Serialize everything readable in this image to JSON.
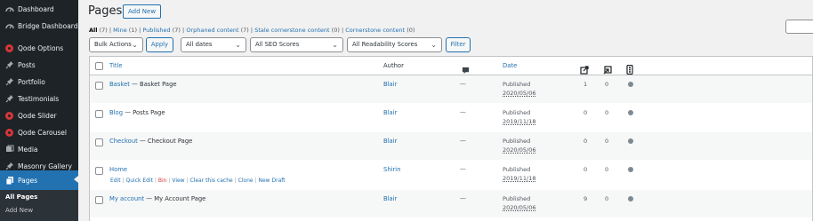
{
  "sidebar": {
    "items": [
      {
        "label": "Dashboard",
        "icon": "dashboard-icon"
      },
      {
        "label": "Bridge Dashboard",
        "icon": "bridge-icon"
      },
      {
        "label": "Qode Options",
        "icon": "qode-icon"
      },
      {
        "label": "Posts",
        "icon": "pin-icon"
      },
      {
        "label": "Portfolio",
        "icon": "pin-icon"
      },
      {
        "label": "Testimonials",
        "icon": "pin-icon"
      },
      {
        "label": "Qode Slider",
        "icon": "qode-icon"
      },
      {
        "label": "Qode Carousel",
        "icon": "qode-icon"
      },
      {
        "label": "Media",
        "icon": "media-icon"
      },
      {
        "label": "Masonry Gallery",
        "icon": "pin-icon"
      },
      {
        "label": "Pages",
        "icon": "pages-icon"
      }
    ],
    "submenu": {
      "all_pages": "All Pages",
      "add_new": "Add New"
    }
  },
  "header": {
    "title": "Pages",
    "add_new": "Add New"
  },
  "filters_links": {
    "all": "All",
    "all_count": "(7)",
    "mine": "Mine",
    "mine_count": "(1)",
    "published": "Published",
    "published_count": "(7)",
    "orphaned": "Orphaned content",
    "orphaned_count": "(7)",
    "stale": "Stale cornerstone content",
    "stale_count": "(0)",
    "cornerstone": "Cornerstone content",
    "cornerstone_count": "(0)",
    "sep": "|"
  },
  "toolbar": {
    "bulk_actions": "Bulk Actions",
    "apply": "Apply",
    "all_dates": "All dates",
    "seo_scores": "All SEO Scores",
    "readability_scores": "All Readability Scores",
    "filter": "Filter"
  },
  "table": {
    "headers": {
      "title": "Title",
      "author": "Author",
      "date": "Date"
    },
    "rows": [
      {
        "title": "Basket",
        "suffix": " — Basket Page",
        "author": "Blair",
        "comments": "—",
        "status": "Published",
        "date": "2020/05/06",
        "links_out": "1",
        "links_in": "0"
      },
      {
        "title": "Blog",
        "suffix": " — Posts Page",
        "author": "Blair",
        "comments": "—",
        "status": "Published",
        "date": "2019/11/18",
        "links_out": "0",
        "links_in": "0"
      },
      {
        "title": "Checkout",
        "suffix": " — Checkout Page",
        "author": "Blair",
        "comments": "—",
        "status": "Published",
        "date": "2020/05/06",
        "links_out": "0",
        "links_in": "0"
      },
      {
        "title": "Home",
        "suffix": "",
        "author": "Shirin",
        "comments": "—",
        "status": "Published",
        "date": "2019/11/18",
        "links_out": "0",
        "links_in": "0"
      },
      {
        "title": "My account",
        "suffix": " — My Account Page",
        "author": "Blair",
        "comments": "—",
        "status": "Published",
        "date": "2020/05/06",
        "links_out": "9",
        "links_in": "0"
      }
    ],
    "row_actions": {
      "edit": "Edit",
      "quick_edit": "Quick Edit",
      "bin": "Bin",
      "view": "View",
      "clear_cache": "Clear this cache",
      "clone": "Clone",
      "new_draft": "New Draft",
      "sep": "|"
    }
  },
  "colors": {
    "accent": "#2271b1",
    "sidebar": "#1d2327",
    "danger": "#d63638"
  }
}
